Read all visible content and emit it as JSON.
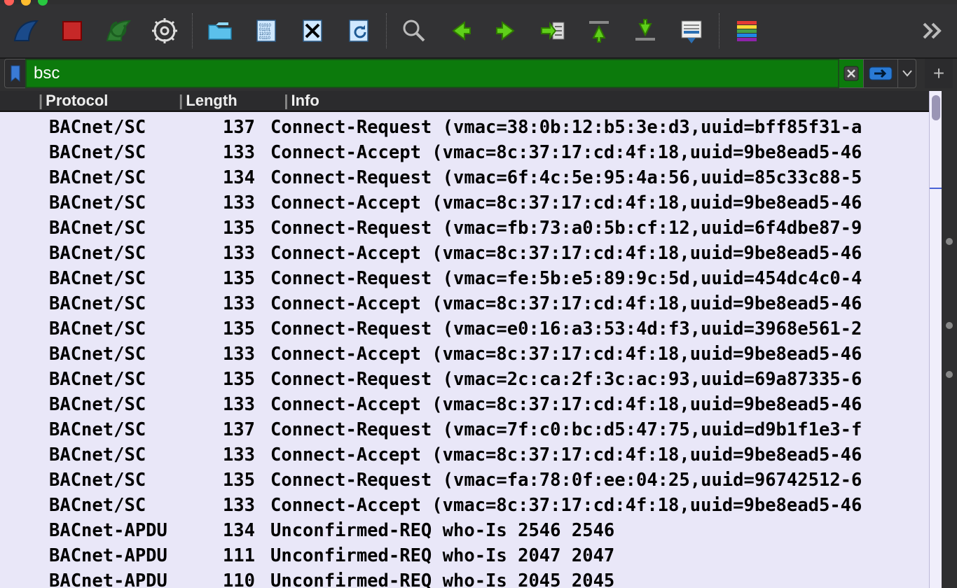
{
  "traffic_lights": [
    "red",
    "yellow",
    "green"
  ],
  "toolbar": {
    "shark_icon": "shark-fin-icon",
    "stop_icon": "stop-icon",
    "restart_icon": "restart-capture-icon",
    "options_icon": "gear-icon",
    "open_icon": "folder-open-icon",
    "save_icon": "save-file-icon",
    "close_icon": "close-file-icon",
    "reload_icon": "reload-file-icon",
    "find_icon": "search-icon",
    "prev_icon": "go-back-icon",
    "next_icon": "go-forward-icon",
    "jump_icon": "go-to-packet-icon",
    "first_icon": "go-first-icon",
    "last_icon": "go-last-icon",
    "autoscroll_icon": "autoscroll-icon",
    "colorize_icon": "colorize-icon",
    "more_icon": "chevrons-right-icon"
  },
  "filter": {
    "value": "bsc",
    "bookmark_icon": "bookmark-icon",
    "clear_icon": "clear-x-icon",
    "apply_icon": "apply-arrow-icon",
    "dropdown_icon": "chevron-down-icon",
    "add_label": "+"
  },
  "columns": {
    "protocol": "Protocol",
    "length": "Length",
    "info": "Info"
  },
  "packets": [
    {
      "protocol": "BACnet/SC",
      "length": "137",
      "info": "Connect-Request (vmac=38:0b:12:b5:3e:d3,uuid=bff85f31-a"
    },
    {
      "protocol": "BACnet/SC",
      "length": "133",
      "info": "Connect-Accept (vmac=8c:37:17:cd:4f:18,uuid=9be8ead5-46"
    },
    {
      "protocol": "BACnet/SC",
      "length": "134",
      "info": "Connect-Request (vmac=6f:4c:5e:95:4a:56,uuid=85c33c88-5"
    },
    {
      "protocol": "BACnet/SC",
      "length": "133",
      "info": "Connect-Accept (vmac=8c:37:17:cd:4f:18,uuid=9be8ead5-46"
    },
    {
      "protocol": "BACnet/SC",
      "length": "135",
      "info": "Connect-Request (vmac=fb:73:a0:5b:cf:12,uuid=6f4dbe87-9"
    },
    {
      "protocol": "BACnet/SC",
      "length": "133",
      "info": "Connect-Accept (vmac=8c:37:17:cd:4f:18,uuid=9be8ead5-46"
    },
    {
      "protocol": "BACnet/SC",
      "length": "135",
      "info": "Connect-Request (vmac=fe:5b:e5:89:9c:5d,uuid=454dc4c0-4"
    },
    {
      "protocol": "BACnet/SC",
      "length": "133",
      "info": "Connect-Accept (vmac=8c:37:17:cd:4f:18,uuid=9be8ead5-46"
    },
    {
      "protocol": "BACnet/SC",
      "length": "135",
      "info": "Connect-Request (vmac=e0:16:a3:53:4d:f3,uuid=3968e561-2"
    },
    {
      "protocol": "BACnet/SC",
      "length": "133",
      "info": "Connect-Accept (vmac=8c:37:17:cd:4f:18,uuid=9be8ead5-46"
    },
    {
      "protocol": "BACnet/SC",
      "length": "135",
      "info": "Connect-Request (vmac=2c:ca:2f:3c:ac:93,uuid=69a87335-6"
    },
    {
      "protocol": "BACnet/SC",
      "length": "133",
      "info": "Connect-Accept (vmac=8c:37:17:cd:4f:18,uuid=9be8ead5-46"
    },
    {
      "protocol": "BACnet/SC",
      "length": "137",
      "info": "Connect-Request (vmac=7f:c0:bc:d5:47:75,uuid=d9b1f1e3-f"
    },
    {
      "protocol": "BACnet/SC",
      "length": "133",
      "info": "Connect-Accept (vmac=8c:37:17:cd:4f:18,uuid=9be8ead5-46"
    },
    {
      "protocol": "BACnet/SC",
      "length": "135",
      "info": "Connect-Request (vmac=fa:78:0f:ee:04:25,uuid=96742512-6"
    },
    {
      "protocol": "BACnet/SC",
      "length": "133",
      "info": "Connect-Accept (vmac=8c:37:17:cd:4f:18,uuid=9be8ead5-46"
    },
    {
      "protocol": "BACnet-APDU",
      "length": "134",
      "info": "Unconfirmed-REQ who-Is 2546 2546"
    },
    {
      "protocol": "BACnet-APDU",
      "length": "111",
      "info": "Unconfirmed-REQ who-Is 2047 2047"
    },
    {
      "protocol": "BACnet-APDU",
      "length": "110",
      "info": "Unconfirmed-REQ who-Is 2045 2045"
    }
  ],
  "colors": {
    "filter_valid_bg": "#0c7a0c",
    "packet_row_bg": "#e9e7f8",
    "toolbar_bg": "#323234"
  }
}
